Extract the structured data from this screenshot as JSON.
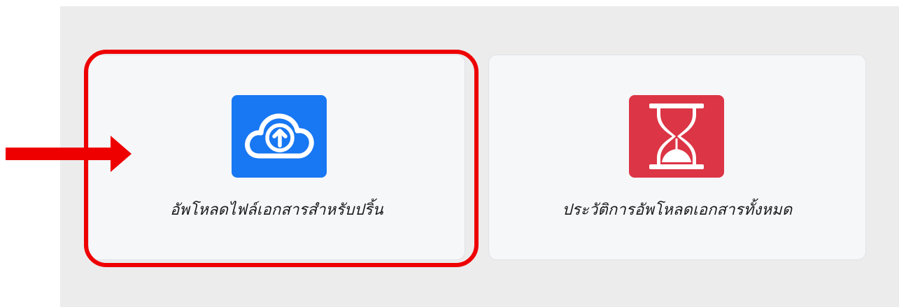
{
  "cards": [
    {
      "label": "อัพโหลดไฟล์เอกสารสำหรับปริ้น",
      "icon": "cloud-upload-icon",
      "color": "#1877f2"
    },
    {
      "label": "ประวัติการอัพโหลดเอกสารทั้งหมด",
      "icon": "hourglass-icon",
      "color": "#dc3545"
    }
  ],
  "annotation": {
    "highlight_color": "#ee0000",
    "arrow_color": "#ee0000"
  }
}
